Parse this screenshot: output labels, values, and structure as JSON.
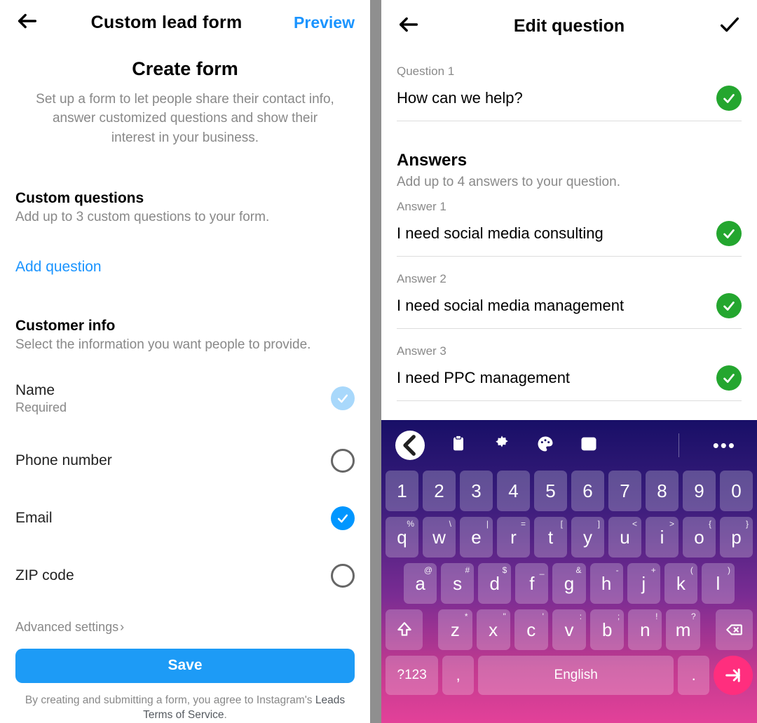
{
  "left": {
    "header": {
      "title": "Custom lead form",
      "preview": "Preview"
    },
    "heading": "Create form",
    "subheading": "Set up a form to let people share their contact info, answer customized questions and show their interest in your business.",
    "custom_questions": {
      "title": "Custom questions",
      "sub": "Add up to 3 custom questions to your form.",
      "add_link": "Add question"
    },
    "customer_info": {
      "title": "Customer info",
      "sub": "Select the information you want people to provide.",
      "fields": [
        {
          "label": "Name",
          "note": "Required",
          "state": "locked"
        },
        {
          "label": "Phone number",
          "note": "",
          "state": "empty"
        },
        {
          "label": "Email",
          "note": "",
          "state": "checked"
        },
        {
          "label": "ZIP code",
          "note": "",
          "state": "empty"
        }
      ]
    },
    "advanced": "Advanced settings",
    "save": "Save",
    "tos_prefix": "By creating and submitting a form, you agree to Instagram's ",
    "tos_link": "Leads Terms of Service",
    "tos_suffix": "."
  },
  "right": {
    "header": {
      "title": "Edit question"
    },
    "question": {
      "label": "Question 1",
      "text": "How can we help?"
    },
    "answers": {
      "title": "Answers",
      "sub": "Add up to 4 answers to your question.",
      "items": [
        {
          "label": "Answer 1",
          "text": "I need social media consulting"
        },
        {
          "label": "Answer 2",
          "text": "I need social media management"
        },
        {
          "label": "Answer 3",
          "text": "I need PPC management"
        }
      ]
    },
    "keyboard": {
      "row_num": [
        "1",
        "2",
        "3",
        "4",
        "5",
        "6",
        "7",
        "8",
        "9",
        "0"
      ],
      "row_q": [
        {
          "k": "q",
          "s": "%"
        },
        {
          "k": "w",
          "s": "\\"
        },
        {
          "k": "e",
          "s": "|"
        },
        {
          "k": "r",
          "s": "="
        },
        {
          "k": "t",
          "s": "["
        },
        {
          "k": "y",
          "s": "]"
        },
        {
          "k": "u",
          "s": "<"
        },
        {
          "k": "i",
          "s": ">"
        },
        {
          "k": "o",
          "s": "{"
        },
        {
          "k": "p",
          "s": "}"
        }
      ],
      "row_a": [
        {
          "k": "a",
          "s": "@"
        },
        {
          "k": "s",
          "s": "#"
        },
        {
          "k": "d",
          "s": "$"
        },
        {
          "k": "f",
          "s": "_"
        },
        {
          "k": "g",
          "s": "&"
        },
        {
          "k": "h",
          "s": "-"
        },
        {
          "k": "j",
          "s": "+"
        },
        {
          "k": "k",
          "s": "("
        },
        {
          "k": "l",
          "s": ")"
        }
      ],
      "row_z": [
        {
          "k": "z",
          "s": "*"
        },
        {
          "k": "x",
          "s": "\""
        },
        {
          "k": "c",
          "s": "'"
        },
        {
          "k": "v",
          "s": ":"
        },
        {
          "k": "b",
          "s": ";"
        },
        {
          "k": "n",
          "s": "!"
        },
        {
          "k": "m",
          "s": "?"
        }
      ],
      "sym": "?123",
      "space": "English",
      "comma": ",",
      "period": "."
    }
  }
}
